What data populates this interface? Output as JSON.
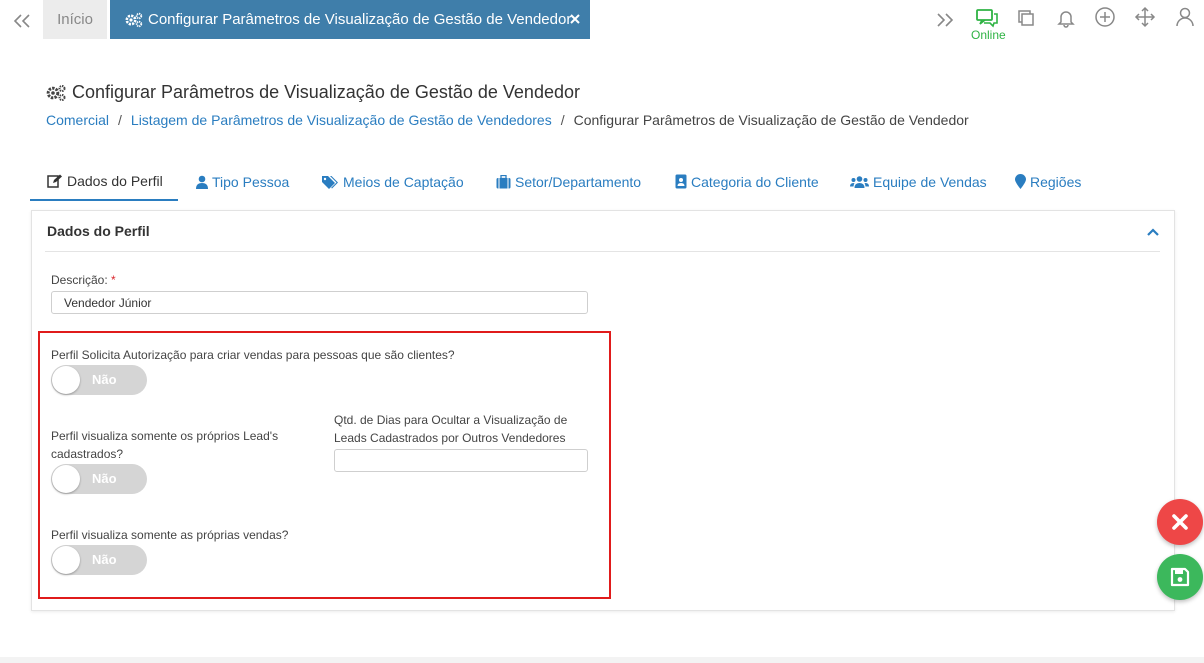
{
  "topbar": {
    "home_tab": "Início",
    "active_tab": "Configurar Parâmetros de Visualização de Gestão de Vendedor",
    "online_label": "Online"
  },
  "header": {
    "title": "Configurar Parâmetros de Visualização de Gestão de Vendedor",
    "breadcrumb": {
      "item1": "Comercial",
      "item2": "Listagem de Parâmetros de Visualização de Gestão de Vendedores",
      "current": "Configurar Parâmetros de Visualização de Gestão de Vendedor",
      "separator": "/"
    }
  },
  "tabs": [
    {
      "label": "Dados do Perfil",
      "icon": "edit-icon"
    },
    {
      "label": "Tipo Pessoa",
      "icon": "user-icon"
    },
    {
      "label": "Meios de Captação",
      "icon": "tags-icon"
    },
    {
      "label": "Setor/Departamento",
      "icon": "briefcase-icon"
    },
    {
      "label": "Categoria do Cliente",
      "icon": "id-badge-icon"
    },
    {
      "label": "Equipe de Vendas",
      "icon": "users-icon"
    },
    {
      "label": "Regiões",
      "icon": "map-marker-icon"
    }
  ],
  "card": {
    "title": "Dados do Perfil",
    "descricao_label": "Descrição:",
    "required_mark": "*",
    "descricao_value": "Vendedor Júnior",
    "q1_label": "Perfil Solicita Autorização para criar vendas para pessoas que são clientes?",
    "q1_toggle": "Não",
    "q2_label_line1": "Perfil visualiza somente os próprios Lead's",
    "q2_label_line2": "cadastrados?",
    "q2_toggle": "Não",
    "dias_label_line1": "Qtd. de Dias para Ocultar a Visualização de",
    "dias_label_line2": "Leads Cadastrados por Outros Vendedores",
    "dias_value": "",
    "q3_label": "Perfil visualiza somente as próprias vendas?",
    "q3_toggle": "Não"
  },
  "colors": {
    "active_tab_bg": "#3f7eaa",
    "link": "#2a7dc0",
    "online": "#2fb344",
    "highlight_border": "#e01b1b",
    "fab_cancel": "#ee4747",
    "fab_save": "#3cb85c",
    "toggle_off": "#d5d5d5"
  }
}
